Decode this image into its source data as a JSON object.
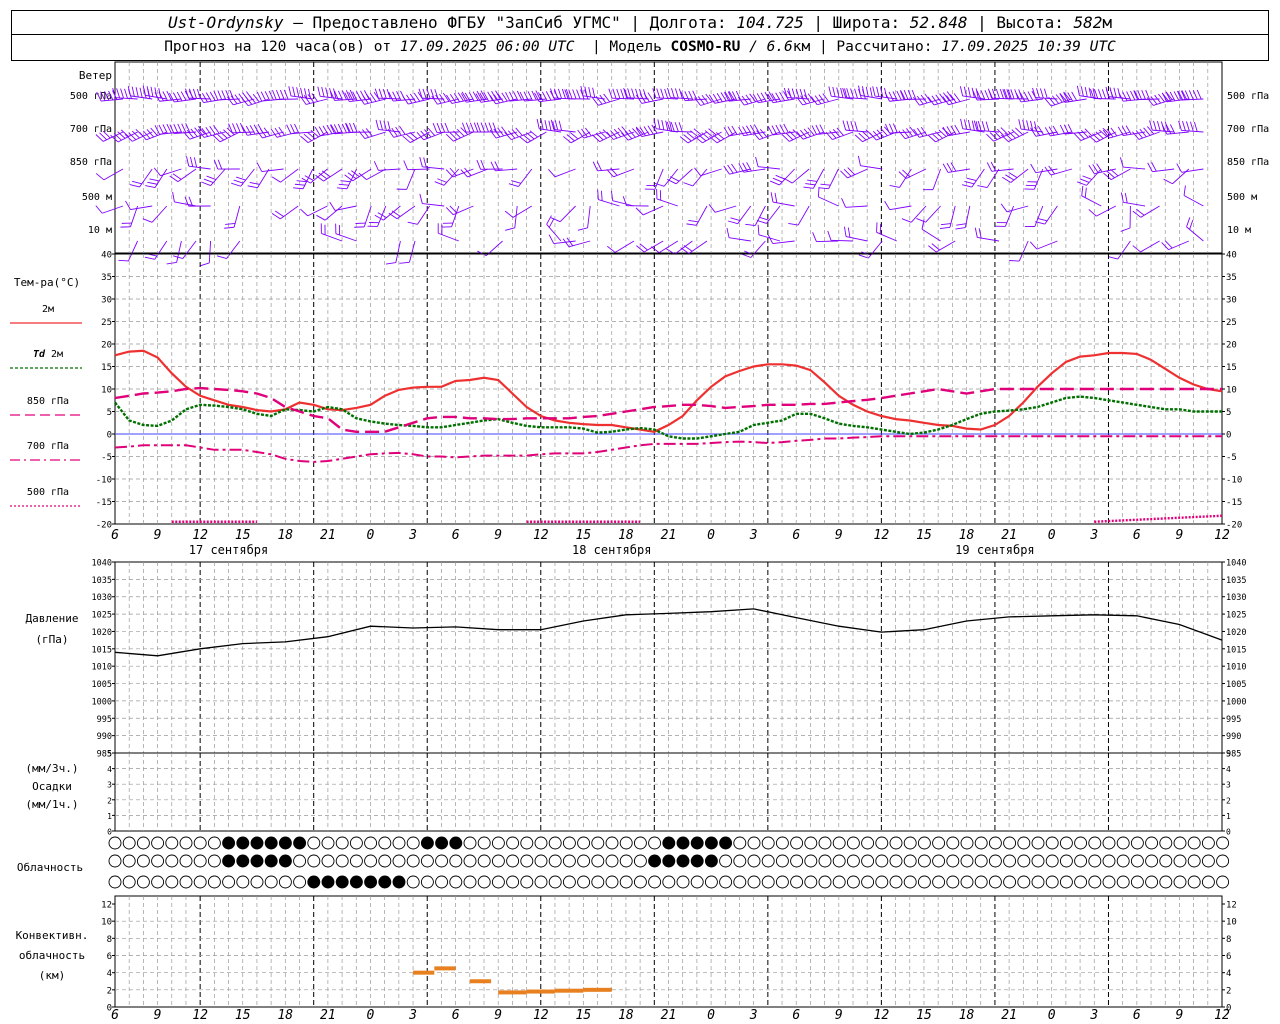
{
  "header": {
    "station": "Ust-Ordynsky",
    "provider": " — Предоставлено ФГБУ \"ЗапСиб УГМС\" | ",
    "lon_label": "Долгота: ",
    "lon_value": "104.725",
    "lat_sep": " | Широта: ",
    "lat_value": "52.848",
    "alt_sep": " | Высота: ",
    "alt_value": "582",
    "alt_unit": "м",
    "forecast_label": "Прогноз на 120 часа(ов) от ",
    "forecast_time": "17.09.2025 06:00 UTC",
    "model_label": "  | Модель ",
    "model_name": "COSMO-RU",
    "model_res": " / 6.6",
    "model_res_unit": "км",
    "calc_label": " | Рассчитано: ",
    "calc_time": "17.09.2025 10:39 UTC"
  },
  "colors": {
    "wind": "#8000ff",
    "t2m": "#ee3030",
    "td2m": "#007000",
    "t850": "#e0007a",
    "t700": "#e0007a",
    "t500": "#e0007a",
    "pressure": "#000000",
    "zero_line": "#4040ff",
    "conv": "#e88020",
    "grid": "#999999"
  },
  "wind_panel": {
    "title": "Ветер",
    "levels": [
      "500 гПа",
      "700 гПа",
      "850 гПа",
      "500 м",
      "10  м"
    ],
    "right_levels": [
      "500 гПа",
      "700 гПа",
      "850 гПа",
      "500 м",
      "10  м"
    ]
  },
  "temp_panel": {
    "title": "Тем-ра(°С)",
    "legend": [
      {
        "label": "2м",
        "style": "solid"
      },
      {
        "label_it": "Td",
        "label": " 2м",
        "style": "dotted"
      },
      {
        "label": "850 гПа",
        "style": "longdash"
      },
      {
        "label": "700 гПа",
        "style": "dashdot"
      },
      {
        "label": "500 гПа",
        "style": "dotted"
      }
    ]
  },
  "pressure_panel": {
    "title": "Давление",
    "unit": "(гПа)"
  },
  "precip_panel": {
    "unit_top": "(мм/3ч.)",
    "title": "Осадки",
    "unit_bottom": "(мм/1ч.)"
  },
  "cloud_panel": {
    "title": "Облачность"
  },
  "conv_panel": {
    "title_1": "Конвективн.",
    "title_2": "облачность",
    "unit": "(км)"
  },
  "x_axis": {
    "hour_labels": [
      "6",
      "9",
      "12",
      "15",
      "18",
      "21",
      "0",
      "3",
      "6",
      "9",
      "12",
      "15",
      "18",
      "21",
      "0",
      "3",
      "6",
      "9",
      "12",
      "15",
      "18",
      "21",
      "0",
      "3",
      "6",
      "9",
      "12"
    ],
    "date_labels": [
      "17 сентября",
      "18 сентября",
      "19 сентября"
    ]
  },
  "chart_data": [
    {
      "type": "line",
      "name": "temperature",
      "x_hours": [
        0,
        3,
        6,
        9,
        12,
        15,
        18,
        21,
        24,
        27,
        30,
        33,
        36,
        39,
        42,
        45,
        48,
        51,
        54,
        57,
        60,
        63,
        66,
        69,
        72,
        75,
        78,
        81,
        84,
        87,
        90,
        93,
        96,
        99,
        102,
        105,
        108,
        111,
        114,
        117,
        120,
        123,
        126,
        129,
        132,
        135,
        138,
        141,
        144,
        147,
        150,
        153,
        156,
        159,
        162,
        165,
        168,
        171,
        174,
        177,
        180,
        183,
        186,
        189,
        192,
        195,
        198,
        201,
        204,
        207,
        210,
        213,
        216,
        219,
        222,
        225,
        228,
        231,
        234
      ],
      "series": [
        {
          "name": "2м",
          "values": [
            17.5,
            18.3,
            18.5,
            17,
            13.5,
            10.5,
            8.5,
            7.5,
            6.5,
            6,
            5.3,
            5,
            5.5,
            7,
            6.5,
            5.5,
            5.3,
            5.8,
            6.5,
            8.5,
            9.8,
            10.3,
            10.5,
            10.5,
            11.8,
            12,
            12.5,
            12,
            9,
            6,
            4,
            3,
            2.5,
            2.2,
            2,
            2,
            1.5,
            1,
            0.5,
            2,
            4,
            7.5,
            10.5,
            12.8,
            14,
            15,
            15.5,
            15.5,
            15.2,
            14.2,
            11.5,
            8.5,
            6.5,
            5,
            4,
            3.3,
            3,
            2.5,
            2,
            1.8,
            1.2,
            1,
            2,
            4,
            7,
            10.5,
            13.5,
            16,
            17.2,
            17.5,
            18,
            18,
            17.8,
            16.5,
            14.5,
            12.5,
            11,
            10,
            9.5
          ]
        },
        {
          "name": "Td 2м",
          "values": [
            7,
            3,
            2,
            1.8,
            3,
            5.5,
            6.5,
            6.3,
            6,
            5.5,
            4.5,
            4,
            5.5,
            5.3,
            5,
            6,
            5.5,
            3.5,
            2.8,
            2.3,
            2,
            1.8,
            1.5,
            1.5,
            2,
            2.5,
            3,
            3.3,
            2.5,
            1.8,
            1.5,
            1.5,
            1.5,
            1.2,
            0.3,
            0.5,
            1,
            1.3,
            1,
            -0.5,
            -1,
            -1,
            -0.5,
            0,
            0.5,
            2,
            2.5,
            3,
            4.5,
            4.5,
            3.5,
            2.3,
            1.8,
            1.5,
            1,
            0.5,
            0,
            0.3,
            1,
            2,
            3.3,
            4.5,
            5,
            5.2,
            5.5,
            6,
            7,
            8,
            8.3,
            8,
            7.5,
            7,
            6.5,
            6,
            5.5,
            5.5,
            5,
            5,
            5
          ]
        },
        {
          "name": "850 гПа",
          "values": [
            8,
            8.5,
            9,
            9.2,
            9.5,
            10,
            10.2,
            10,
            9.8,
            9.5,
            9,
            8,
            6,
            5,
            4,
            3.5,
            1,
            0.5,
            0.5,
            0.5,
            1.5,
            2.5,
            3.5,
            3.8,
            3.8,
            3.5,
            3.5,
            3.3,
            3.3,
            3.5,
            3.5,
            3.5,
            3.5,
            3.8,
            4,
            4.5,
            5,
            5.5,
            6,
            6.2,
            6.5,
            6.5,
            6.2,
            5.8,
            6,
            6.2,
            6.5,
            6.5,
            6.5,
            6.7,
            6.7,
            7,
            7.3,
            7.6,
            8,
            8.5,
            9,
            9.5,
            10,
            9.5,
            9,
            9.5,
            10,
            10,
            10,
            10,
            10,
            10,
            10,
            10,
            10,
            10,
            10,
            10,
            10,
            10,
            10,
            10,
            10
          ]
        },
        {
          "name": "700 гПа",
          "values": [
            -3,
            -2.8,
            -2.5,
            -2.5,
            -2.5,
            -2.5,
            -3,
            -3.5,
            -3.5,
            -3.5,
            -4,
            -4.5,
            -5.5,
            -6,
            -6.2,
            -6,
            -5.5,
            -5,
            -4.5,
            -4.3,
            -4.2,
            -4.5,
            -5,
            -5,
            -5.2,
            -5,
            -4.8,
            -4.8,
            -4.8,
            -4.8,
            -4.5,
            -4.3,
            -4.3,
            -4.3,
            -4,
            -3.5,
            -3,
            -2.5,
            -2.2,
            -2.2,
            -2.2,
            -2.2,
            -2,
            -1.8,
            -1.7,
            -1.8,
            -2,
            -1.8,
            -1.5,
            -1.3,
            -1,
            -1,
            -0.8,
            -0.7,
            -0.5,
            -0.5,
            -0.5,
            -0.5,
            -0.5,
            -0.5,
            -0.5,
            -0.5,
            -0.5,
            -0.5,
            -0.5,
            -0.5,
            -0.5,
            -0.5,
            -0.5,
            -0.5,
            -0.5,
            -0.5,
            -0.5,
            -0.5,
            -0.5,
            -0.5,
            -0.5,
            -0.5,
            -0.5
          ]
        }
      ],
      "ylabel": "Тем-ра(°С)",
      "ylim": [
        -20,
        40
      ],
      "grid": true
    },
    {
      "type": "line",
      "name": "pressure",
      "x_hours": [
        0,
        6,
        12,
        18,
        24,
        30,
        36,
        42,
        48,
        54,
        60,
        66,
        72,
        78,
        84,
        90,
        96,
        102,
        108,
        114,
        120,
        126,
        132,
        138,
        144,
        150,
        156
      ],
      "series": [
        {
          "name": "Давление",
          "values": [
            1014,
            1013,
            1015,
            1016.5,
            1017,
            1018.5,
            1021.5,
            1021,
            1021.3,
            1020.5,
            1020.5,
            1023,
            1024.8,
            1025.2,
            1025.7,
            1026.5,
            1024,
            1021.5,
            1019.8,
            1020.5,
            1023,
            1024.2,
            1024.5,
            1024.8,
            1024.5,
            1022,
            1017.5
          ]
        }
      ],
      "ylabel": "Давление (гПа)",
      "ylim": [
        985,
        1040
      ],
      "grid": true
    },
    {
      "type": "bar",
      "name": "convective_cloud",
      "series": [
        {
          "name": "Конвективн. облачность (км)",
          "segments": [
            [
              21,
              22.5,
              4
            ],
            [
              22.5,
              24,
              4.5
            ],
            [
              25,
              26.5,
              3
            ],
            [
              27,
              29,
              1.7
            ],
            [
              29,
              31,
              1.8
            ],
            [
              31,
              33,
              1.9
            ],
            [
              33,
              35,
              2
            ]
          ]
        }
      ],
      "ylim": [
        0,
        14
      ],
      "grid": true
    }
  ]
}
